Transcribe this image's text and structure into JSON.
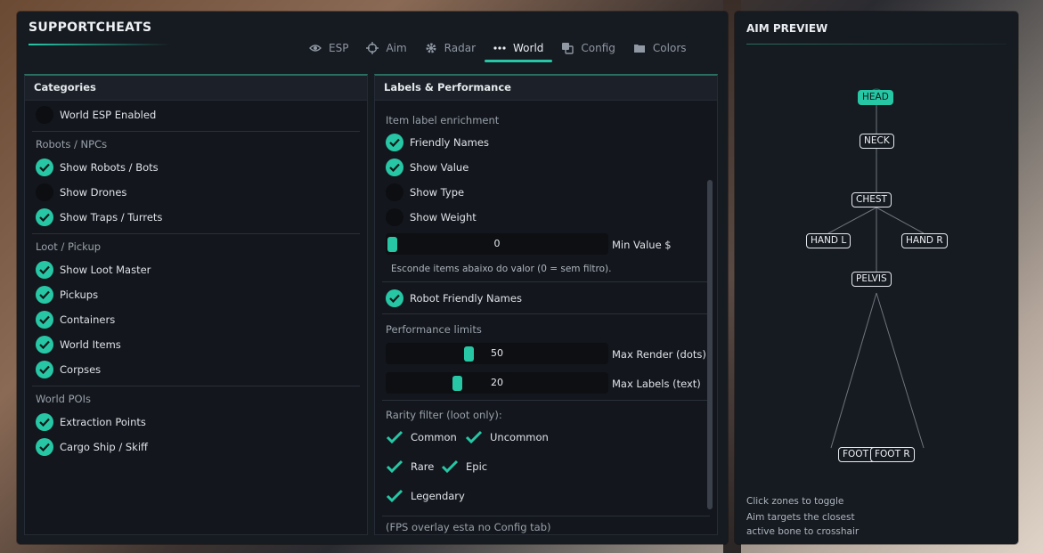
{
  "app": {
    "title": "SUPPORTCHEATS",
    "accent": "#27c7a6"
  },
  "tabs": [
    {
      "label": "ESP",
      "icon": "eye-icon"
    },
    {
      "label": "Aim",
      "icon": "crosshair-icon"
    },
    {
      "label": "Radar",
      "icon": "gear-icon"
    },
    {
      "label": "World",
      "icon": "dots-icon",
      "active": true
    },
    {
      "label": "Config",
      "icon": "copy-icon"
    },
    {
      "label": "Colors",
      "icon": "folder-icon"
    }
  ],
  "categories": {
    "title": "Categories",
    "world_esp": {
      "label": "World ESP Enabled",
      "checked": false
    },
    "robots": {
      "title": "Robots / NPCs",
      "items": [
        {
          "label": "Show Robots / Bots",
          "checked": true
        },
        {
          "label": "Show Drones",
          "checked": false
        },
        {
          "label": "Show Traps / Turrets",
          "checked": true
        }
      ]
    },
    "loot": {
      "title": "Loot / Pickup",
      "items": [
        {
          "label": "Show Loot Master",
          "checked": true
        },
        {
          "label": "Pickups",
          "checked": true
        },
        {
          "label": "Containers",
          "checked": true
        },
        {
          "label": "World Items",
          "checked": true
        },
        {
          "label": "Corpses",
          "checked": true
        }
      ]
    },
    "pois": {
      "title": "World POIs",
      "items": [
        {
          "label": "Extraction Points",
          "checked": true
        },
        {
          "label": "Cargo Ship / Skiff",
          "checked": true
        }
      ]
    }
  },
  "labels": {
    "title": "Labels & Performance",
    "enrich_title": "Item label enrichment",
    "enrich": [
      {
        "label": "Friendly Names",
        "checked": true
      },
      {
        "label": "Show Value",
        "checked": true
      },
      {
        "label": "Show Type",
        "checked": false
      },
      {
        "label": "Show Weight",
        "checked": false
      }
    ],
    "min_value": {
      "value": "0",
      "label": "Min Value $",
      "fraction": 0
    },
    "min_value_note": "Esconde items abaixo do valor (0 = sem filtro).",
    "robot_names": {
      "label": "Robot Friendly Names",
      "checked": true
    },
    "perf_title": "Performance limits",
    "max_render": {
      "value": "50",
      "label": "Max Render (dots)",
      "fraction": 0.38
    },
    "max_labels": {
      "value": "20",
      "label": "Max Labels (text)",
      "fraction": 0.33
    },
    "rarity_title": "Rarity filter (loot only):",
    "rarity": [
      {
        "label": "Common",
        "checked": true
      },
      {
        "label": "Uncommon",
        "checked": true
      },
      {
        "label": "Rare",
        "checked": true
      },
      {
        "label": "Epic",
        "checked": true
      },
      {
        "label": "Legendary",
        "checked": true
      }
    ],
    "fps_note": "(FPS overlay esta no Config tab)"
  },
  "aim": {
    "title": "AIM PREVIEW",
    "bones": {
      "head": "HEAD",
      "neck": "NECK",
      "chest": "CHEST",
      "hand_l": "HAND L",
      "hand_r": "HAND R",
      "pelvis": "PELVIS",
      "foot_l": "FOOT L",
      "foot_r": "FOOT R"
    },
    "active_bone": "HEAD",
    "help": [
      "Click zones to toggle",
      "Aim targets the closest",
      "active bone to crosshair"
    ]
  }
}
